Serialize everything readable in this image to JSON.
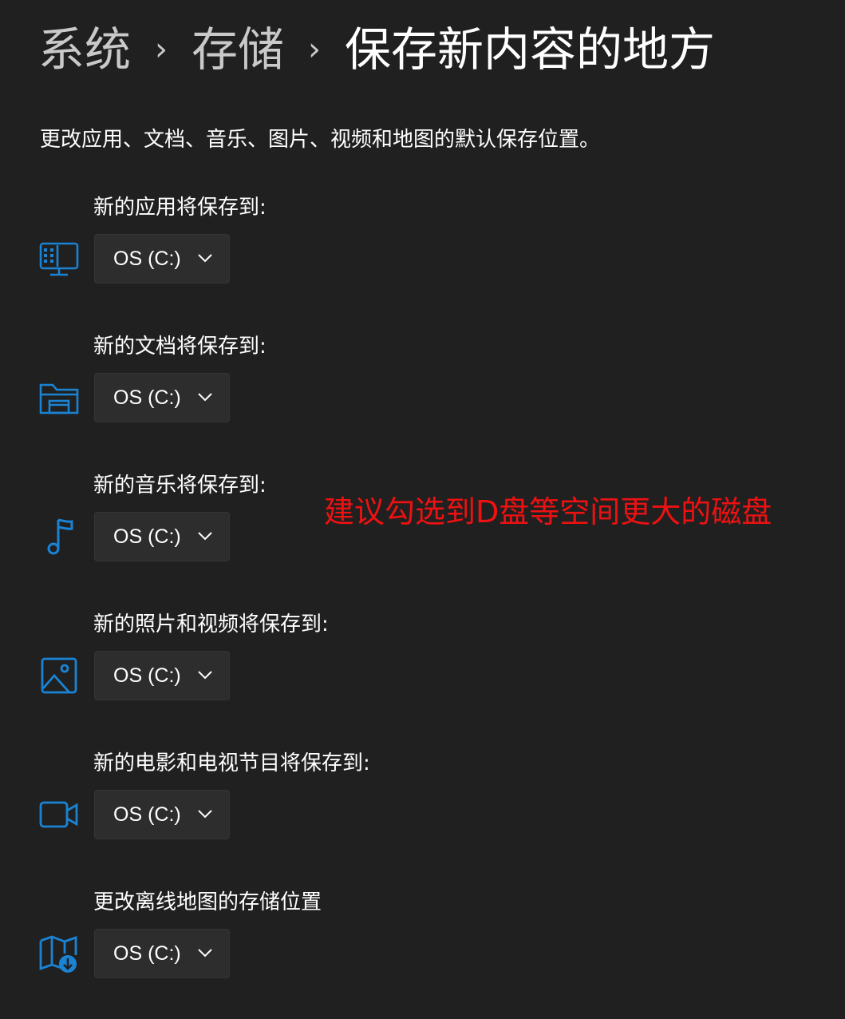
{
  "breadcrumb": {
    "items": [
      "系统",
      "存储",
      "保存新内容的地方"
    ],
    "separator": "›"
  },
  "description": "更改应用、文档、音乐、图片、视频和地图的默认保存位置。",
  "sections": [
    {
      "label": "新的应用将保存到:",
      "icon": "monitor-apps-icon",
      "value": "OS (C:)"
    },
    {
      "label": "新的文档将保存到:",
      "icon": "folder-documents-icon",
      "value": "OS (C:)"
    },
    {
      "label": "新的音乐将保存到:",
      "icon": "music-note-icon",
      "value": "OS (C:)"
    },
    {
      "label": "新的照片和视频将保存到:",
      "icon": "photo-icon",
      "value": "OS (C:)"
    },
    {
      "label": "新的电影和电视节目将保存到:",
      "icon": "video-camera-icon",
      "value": "OS (C:)"
    },
    {
      "label": "更改离线地图的存储位置",
      "icon": "map-download-icon",
      "value": "OS (C:)"
    }
  ],
  "annotation": "建议勾选到D盘等空间更大的磁盘",
  "colors": {
    "background": "#202020",
    "accent": "#1a83d4",
    "dropdown_bg": "#2d2d2d",
    "annotation": "#ee1111"
  }
}
